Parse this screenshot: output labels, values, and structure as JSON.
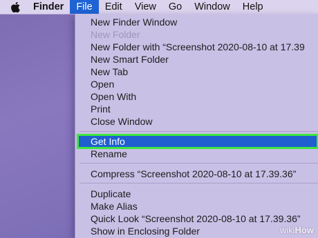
{
  "menubar": {
    "apple_icon": "apple-logo-icon",
    "app_name": "Finder",
    "items": [
      "File",
      "Edit",
      "View",
      "Go",
      "Window",
      "Help"
    ],
    "active": "File"
  },
  "file_menu": {
    "items": [
      {
        "label": "New Finder Window",
        "enabled": true
      },
      {
        "label": "New Folder",
        "enabled": false
      },
      {
        "label": "New Folder with “Screenshot 2020-08-10 at 17.39",
        "enabled": true
      },
      {
        "label": "New Smart Folder",
        "enabled": true
      },
      {
        "label": "New Tab",
        "enabled": true
      },
      {
        "label": "Open",
        "enabled": true
      },
      {
        "label": "Open With",
        "enabled": true
      },
      {
        "label": "Print",
        "enabled": true
      },
      {
        "label": "Close Window",
        "enabled": true
      },
      {
        "label": "Get Info",
        "enabled": true,
        "highlighted": true
      },
      {
        "label": "Rename",
        "enabled": true
      },
      {
        "label": "Compress “Screenshot 2020-08-10 at 17.39.36”",
        "enabled": true
      },
      {
        "label": "Duplicate",
        "enabled": true
      },
      {
        "label": "Make Alias",
        "enabled": true
      },
      {
        "label": "Quick Look “Screenshot 2020-08-10 at 17.39.36”",
        "enabled": true
      },
      {
        "label": "Show in Enclosing Folder",
        "enabled": true
      }
    ]
  },
  "watermark": {
    "part1": "wiki",
    "part2": "How"
  },
  "colors": {
    "highlight": "#1f5fd0",
    "highlight_outline": "#3ee63e",
    "menubar_active": "#1f63d4"
  }
}
